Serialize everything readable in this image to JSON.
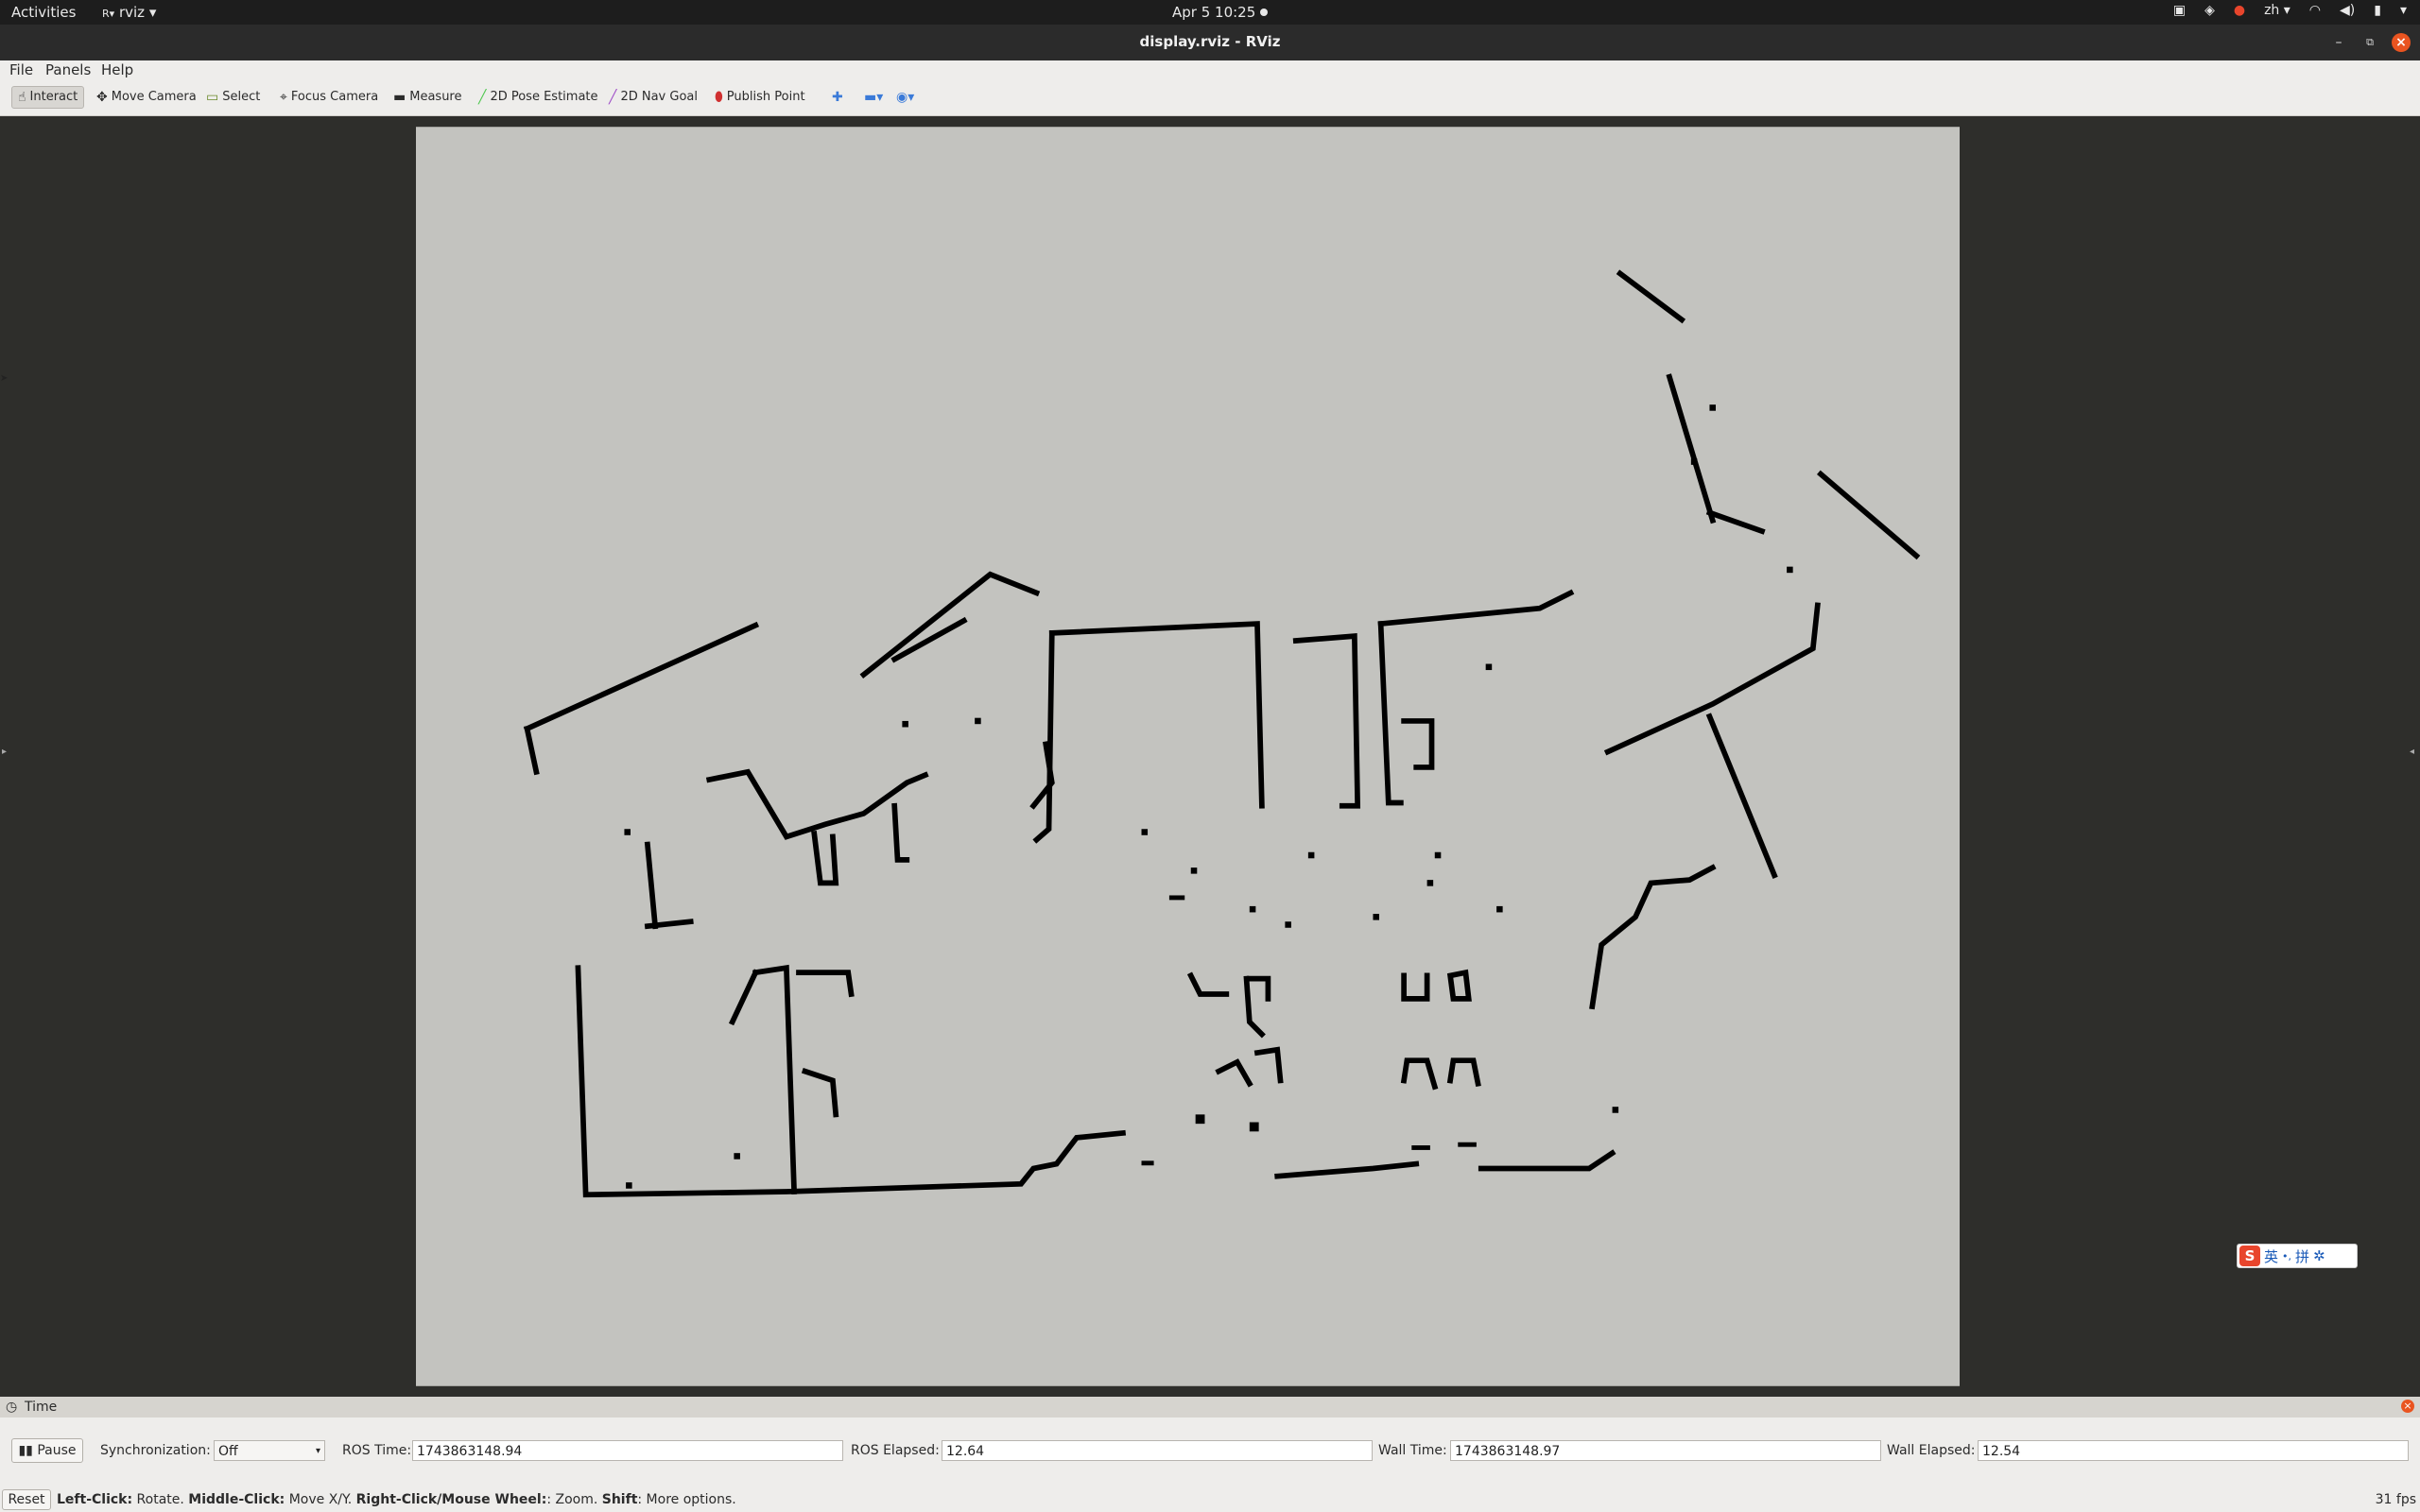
{
  "topbar": {
    "activities": "Activities",
    "app_menu": "rviz",
    "clock": "Apr 5  10:25",
    "lang": "zh"
  },
  "window": {
    "title": "display.rviz - RViz"
  },
  "menu": {
    "file": "File",
    "panels": "Panels",
    "help": "Help"
  },
  "toolbar": {
    "interact": "Interact",
    "move_camera": "Move Camera",
    "select": "Select",
    "focus_camera": "Focus Camera",
    "measure": "Measure",
    "pose_estimate": "2D Pose Estimate",
    "nav_goal": "2D Nav Goal",
    "publish_point": "Publish Point"
  },
  "colors": {
    "map_free": "#c3c3bf",
    "map_occupied": "#000000",
    "background": "#2e2e2b",
    "accent_close": "#e95420",
    "nav_goal": "#a050c8",
    "pose_estimate": "#50c850"
  },
  "ime": {
    "logo": "S",
    "lang": "英",
    "symbols": "•,",
    "mode": "拼"
  },
  "time_panel": {
    "title": "Time",
    "pause_label": "Pause",
    "sync_label": "Synchronization:",
    "sync_value": "Off",
    "ros_time_label": "ROS Time:",
    "ros_time": "1743863148.94",
    "ros_elapsed_label": "ROS Elapsed:",
    "ros_elapsed": "12.64",
    "wall_time_label": "Wall Time:",
    "wall_time": "1743863148.97",
    "wall_elapsed_label": "Wall Elapsed:",
    "wall_elapsed": "12.54"
  },
  "status": {
    "reset_label": "Reset",
    "left_click": "Left-Click:",
    "left_action": " Rotate. ",
    "middle_click": "Middle-Click:",
    "middle_action": " Move X/Y. ",
    "right_click": "Right-Click/Mouse Wheel:",
    "right_action": ": Zoom. ",
    "shift": "Shift",
    "shift_action": ": More options.",
    "fps": "31 fps"
  }
}
